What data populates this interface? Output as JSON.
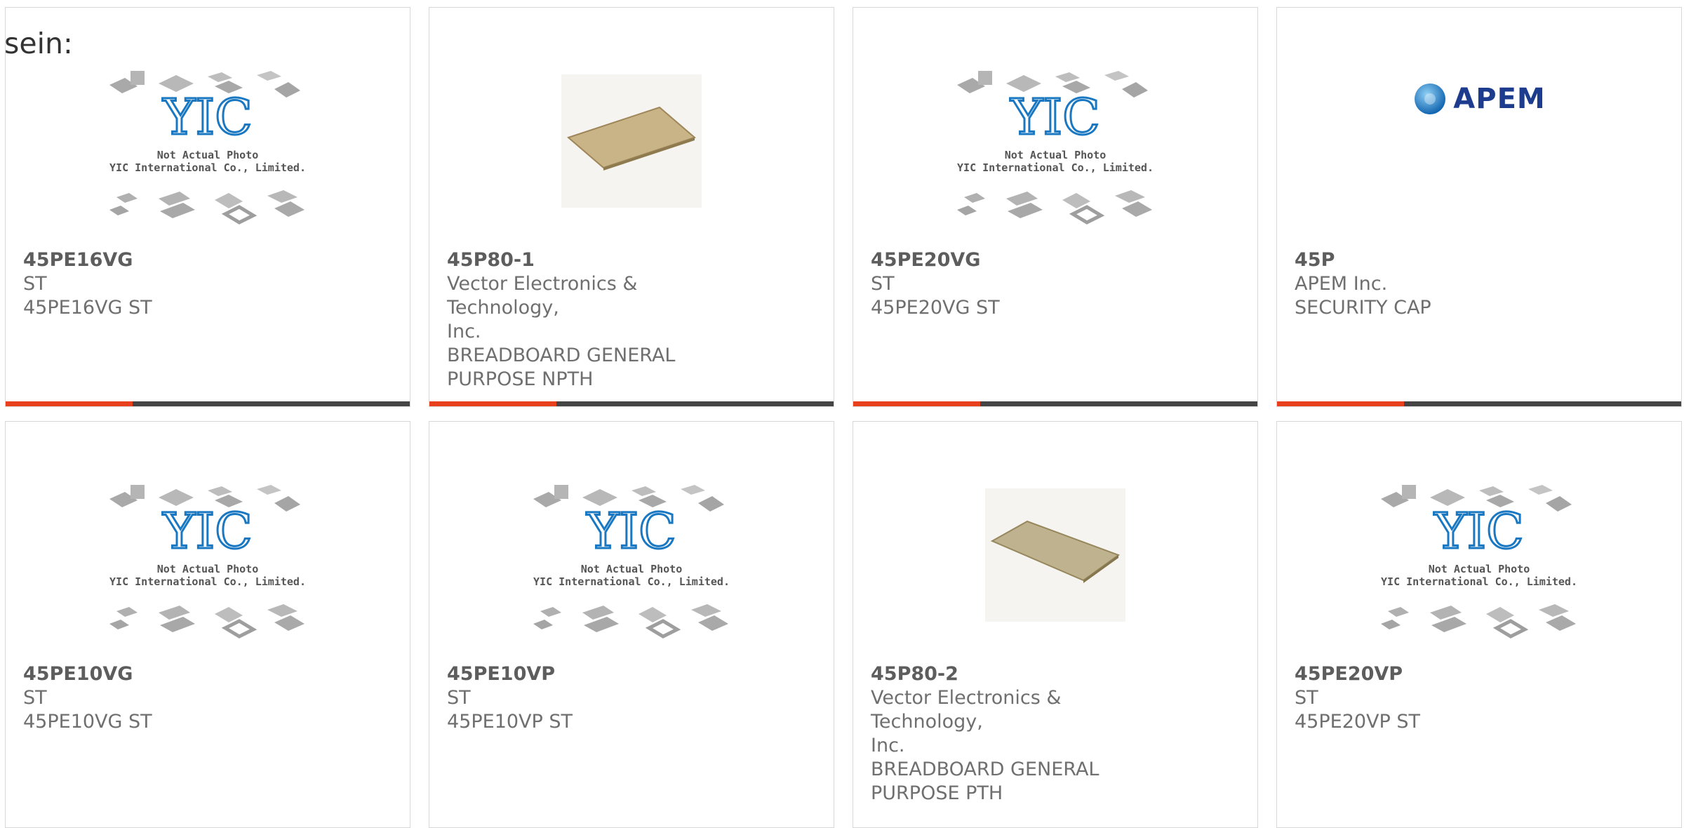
{
  "intro_text": "sein:",
  "placeholder_caption": {
    "line1": "Not Actual Photo",
    "line2": "YIC International Co., Limited."
  },
  "brand_logo_text": "YIC",
  "colors": {
    "accent": "#e8401c",
    "bar": "#444444",
    "text": "#6f6f6f",
    "yic_blue": "#1a78c2",
    "apem_blue": "#1d3c8e"
  },
  "products": [
    {
      "part": "45PE16VG",
      "manufacturer": "ST",
      "description": "45PE16VG ST",
      "image": "yic-placeholder-image"
    },
    {
      "part": "45P80-1",
      "manufacturer": "Vector Electronics & Technology,",
      "manufacturer_cont": "Inc.",
      "description": "BREADBOARD GENERAL",
      "description_cont": "PURPOSE NPTH",
      "image": "breadboard-image"
    },
    {
      "part": "45PE20VG",
      "manufacturer": "ST",
      "description": "45PE20VG ST",
      "image": "yic-placeholder-image"
    },
    {
      "part": "45P",
      "manufacturer": "APEM Inc.",
      "description": "SECURITY CAP",
      "image": "apem-logo",
      "logo_text": "APEM"
    },
    {
      "part": "45PE10VG",
      "manufacturer": "ST",
      "description": "45PE10VG ST",
      "image": "yic-placeholder-image"
    },
    {
      "part": "45PE10VP",
      "manufacturer": "ST",
      "description": "45PE10VP ST",
      "image": "yic-placeholder-image"
    },
    {
      "part": "45P80-2",
      "manufacturer": "Vector Electronics & Technology,",
      "manufacturer_cont": "Inc.",
      "description": "BREADBOARD GENERAL",
      "description_cont": "PURPOSE PTH",
      "image": "breadboard-image"
    },
    {
      "part": "45PE20VP",
      "manufacturer": "ST",
      "description": "45PE20VP ST",
      "image": "yic-placeholder-image"
    }
  ]
}
